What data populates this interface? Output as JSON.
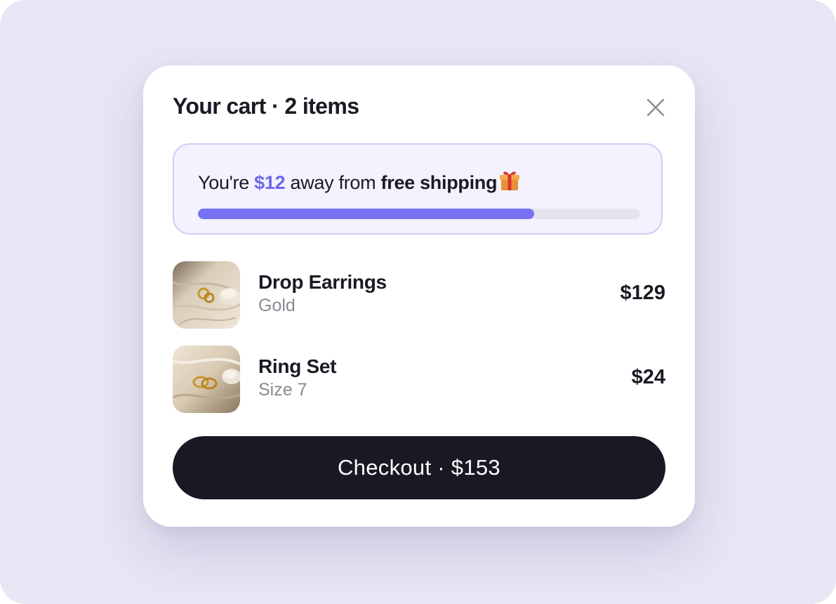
{
  "cart": {
    "title": "Your cart · 2 items",
    "close_icon": "close-icon"
  },
  "shipping": {
    "prefix": "You're ",
    "amount": "$12",
    "middle": " away from ",
    "strong": "free shipping",
    "icon": "gift-icon",
    "progress_fraction": 0.76
  },
  "items": [
    {
      "name": "Drop Earrings",
      "variant": "Gold",
      "price": "$129",
      "image": "gold-earrings-on-linen"
    },
    {
      "name": "Ring Set",
      "variant": "Size 7",
      "price": "$24",
      "image": "gold-rings-on-linen"
    }
  ],
  "checkout": {
    "label": "Checkout · $153"
  },
  "colors": {
    "background": "#e9e5f5",
    "accent": "#6c67f0",
    "progress_fill": "#7672f2",
    "button": "#191823"
  }
}
